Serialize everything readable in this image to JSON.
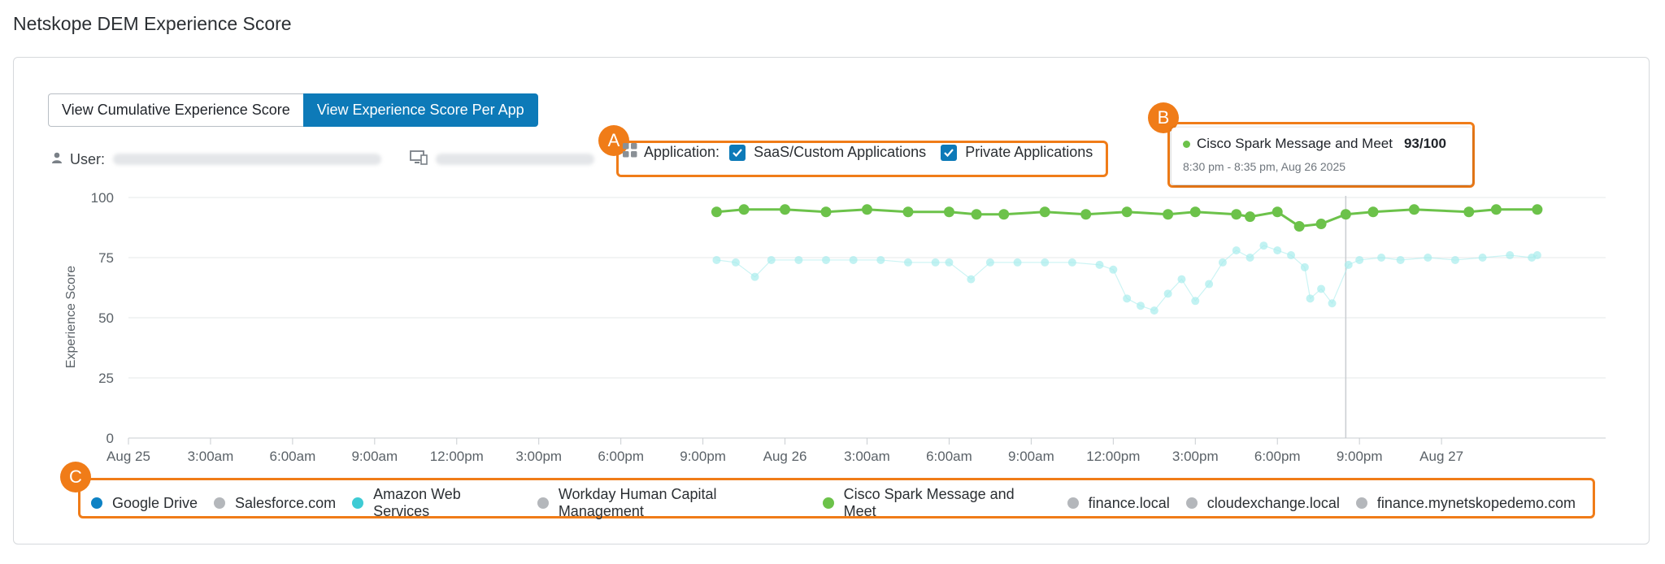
{
  "page_title": "Netskope DEM Experience Score",
  "view_toggle": {
    "cumulative_label": "View Cumulative Experience Score",
    "per_app_label": "View Experience Score Per App",
    "selected": "per_app"
  },
  "meta": {
    "user_label": "User:"
  },
  "app_filter": {
    "label": "Application:",
    "options": [
      {
        "label": "SaaS/Custom Applications",
        "checked": true
      },
      {
        "label": "Private Applications",
        "checked": true
      }
    ]
  },
  "callouts": {
    "a": "A",
    "b": "B",
    "c": "C"
  },
  "tooltip": {
    "app": "Cisco Spark Message and Meet",
    "score": "93/100",
    "time": "8:30 pm - 8:35 pm, Aug 26 2025",
    "color": "#6cc24a"
  },
  "colors": {
    "accent": "#0d7ab8",
    "callout": "#f07c18"
  },
  "chart_data": {
    "type": "scatter",
    "ylabel": "Experience Score",
    "ylim": [
      0,
      100
    ],
    "yticks": [
      0,
      25,
      50,
      75,
      100
    ],
    "x_tick_labels": [
      "Aug 25",
      "3:00am",
      "6:00am",
      "9:00am",
      "12:00pm",
      "3:00pm",
      "6:00pm",
      "9:00pm",
      "Aug 26",
      "3:00am",
      "6:00am",
      "9:00am",
      "12:00pm",
      "3:00pm",
      "6:00pm",
      "9:00pm",
      "Aug 27"
    ],
    "x_unit": "hours from Aug 25 00:00",
    "hover_x": 44.5,
    "grid": true,
    "series": [
      {
        "name": "Cisco Spark Message and Meet",
        "color": "#6cc24a",
        "style": "solid",
        "points": [
          [
            21.5,
            94
          ],
          [
            22.5,
            95
          ],
          [
            24,
            95
          ],
          [
            25.5,
            94
          ],
          [
            27,
            95
          ],
          [
            28.5,
            94
          ],
          [
            30,
            94
          ],
          [
            31,
            93
          ],
          [
            32,
            93
          ],
          [
            33.5,
            94
          ],
          [
            35,
            93
          ],
          [
            36.5,
            94
          ],
          [
            38,
            93
          ],
          [
            39,
            94
          ],
          [
            40.5,
            93
          ],
          [
            41,
            92
          ],
          [
            42,
            94
          ],
          [
            42.8,
            88
          ],
          [
            43.6,
            89
          ],
          [
            44.5,
            93
          ],
          [
            45.5,
            94
          ],
          [
            47,
            95
          ],
          [
            49,
            94
          ],
          [
            50,
            95
          ],
          [
            51.5,
            95
          ]
        ]
      },
      {
        "name": "Amazon Web Services",
        "color": "#a8ecec",
        "style": "faded",
        "points": [
          [
            21.5,
            74
          ],
          [
            22.2,
            73
          ],
          [
            22.9,
            67
          ],
          [
            23.5,
            74
          ],
          [
            24.5,
            74
          ],
          [
            25.5,
            74
          ],
          [
            26.5,
            74
          ],
          [
            27.5,
            74
          ],
          [
            28.5,
            73
          ],
          [
            29.5,
            73
          ],
          [
            30,
            73
          ],
          [
            30.8,
            66
          ],
          [
            31.5,
            73
          ],
          [
            32.5,
            73
          ],
          [
            33.5,
            73
          ],
          [
            34.5,
            73
          ],
          [
            35.5,
            72
          ],
          [
            36,
            70
          ],
          [
            36.5,
            58
          ],
          [
            37,
            55
          ],
          [
            37.5,
            53
          ],
          [
            38,
            60
          ],
          [
            38.5,
            66
          ],
          [
            39,
            57
          ],
          [
            39.5,
            64
          ],
          [
            40,
            73
          ],
          [
            40.5,
            78
          ],
          [
            41,
            75
          ],
          [
            41.5,
            80
          ],
          [
            42,
            78
          ],
          [
            42.5,
            76
          ],
          [
            43,
            71
          ],
          [
            43.2,
            58
          ],
          [
            43.6,
            62
          ],
          [
            44,
            56
          ],
          [
            44.6,
            72
          ],
          [
            45,
            74
          ],
          [
            45.8,
            75
          ],
          [
            46.5,
            74
          ],
          [
            47.5,
            75
          ],
          [
            48.5,
            74
          ],
          [
            49.5,
            75
          ],
          [
            50.5,
            76
          ],
          [
            51.3,
            75
          ],
          [
            51.5,
            76
          ]
        ]
      }
    ],
    "legend": {
      "placement": "bottom",
      "entries": [
        {
          "label": "Google Drive",
          "color": "#0e82c4"
        },
        {
          "label": "Salesforce.com",
          "color": "#b4b7bb"
        },
        {
          "label": "Amazon Web Services",
          "color": "#3ecbd4"
        },
        {
          "label": "Workday Human Capital Management",
          "color": "#b4b7bb"
        },
        {
          "label": "Cisco Spark Message and Meet",
          "color": "#6cc24a"
        },
        {
          "label": "finance.local",
          "color": "#b4b7bb"
        },
        {
          "label": "cloudexchange.local",
          "color": "#b4b7bb"
        },
        {
          "label": "finance.mynetskopedemo.com",
          "color": "#b4b7bb"
        }
      ]
    }
  }
}
